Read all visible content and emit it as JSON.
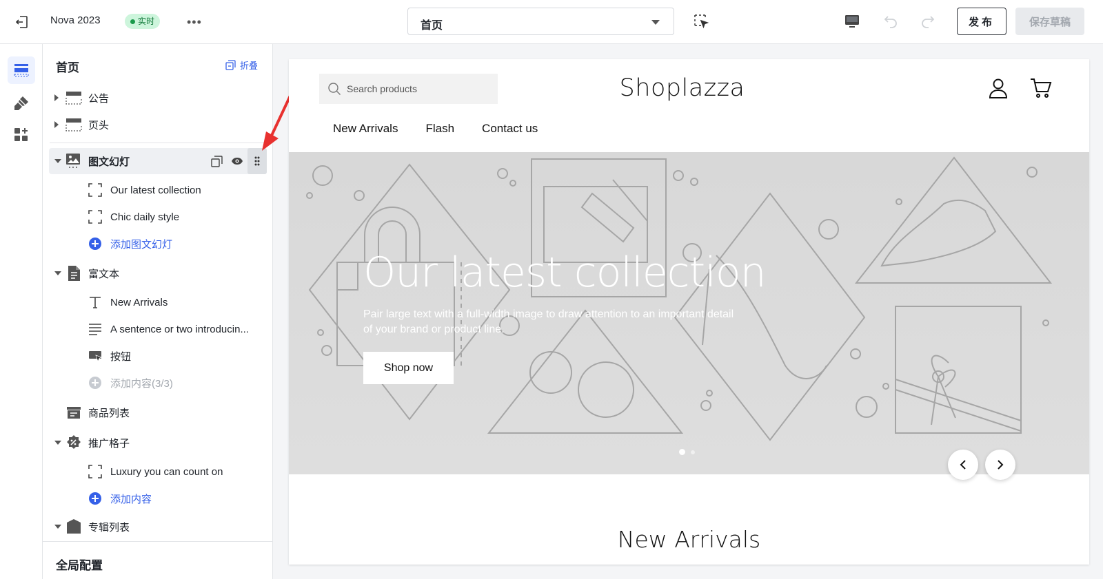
{
  "topbar": {
    "store_name": "Nova 2023",
    "status_badge": "实时",
    "more_label": "•••",
    "page_selector_value": "首页",
    "publish_label": "发布",
    "save_draft_label": "保存草稿"
  },
  "panel": {
    "title": "首页",
    "collapse_label": "折叠",
    "footer_label": "全局配置",
    "sections": [
      {
        "label": "公告",
        "icon": "announcement-icon"
      },
      {
        "label": "页头",
        "icon": "header-icon"
      },
      {
        "label": "图文幻灯",
        "icon": "slideshow-icon"
      },
      {
        "label": "富文本",
        "icon": "rich-text-icon"
      },
      {
        "label": "商品列表",
        "icon": "product-list-icon"
      },
      {
        "label": "推广格子",
        "icon": "promo-grid-icon"
      },
      {
        "label": "专辑列表",
        "icon": "collection-list-icon"
      }
    ],
    "slideshow_blocks": [
      "Our latest collection",
      "Chic daily style"
    ],
    "slideshow_add": "添加图文幻灯",
    "richtext_blocks": [
      {
        "label": "New Arrivals",
        "icon": "heading-icon"
      },
      {
        "label": "A sentence or two introducin...",
        "icon": "paragraph-icon"
      },
      {
        "label": "按钮",
        "icon": "button-icon"
      }
    ],
    "richtext_add": "添加内容(3/3)",
    "promo_blocks": [
      "Luxury you can count on"
    ],
    "promo_add": "添加内容"
  },
  "preview": {
    "search_placeholder": "Search products",
    "logo": "Shoplazza",
    "nav": [
      "New Arrivals",
      "Flash",
      "Contact us"
    ],
    "hero_title": "Our latest collection",
    "hero_subtitle": "Pair large text with a full-width image to draw attention to an important detail of your brand or product line.",
    "hero_button": "Shop now",
    "section_title": "New Arrivals"
  },
  "colors": {
    "accent": "#3560e8",
    "live_badge_bg": "#cdf5dc",
    "annotation_arrow": "#e8312f"
  }
}
